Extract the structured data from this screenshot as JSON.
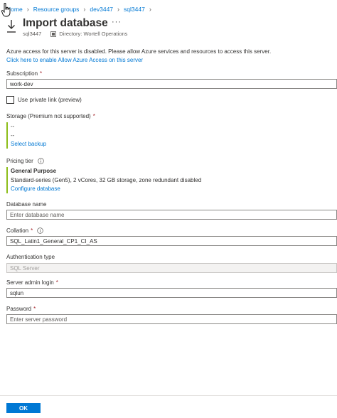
{
  "breadcrumb": [
    "Home",
    "Resource groups",
    "dev3447",
    "sql3447"
  ],
  "header": {
    "title": "Import database",
    "more": "···",
    "server": "sql3447",
    "directory": "Directory: Wortell Operations"
  },
  "notice": {
    "message": "Azure access for this server is disabled. Please allow Azure services and resources to access this server.",
    "link": "Click here to enable Allow Azure Access on this server"
  },
  "subscription": {
    "label": "Subscription",
    "value": "work-dev"
  },
  "private_link": {
    "label": "Use private link (preview)",
    "checked": false
  },
  "storage": {
    "label": "Storage (Premium not supported)",
    "line1": "--",
    "line2": "--",
    "link": "Select backup"
  },
  "pricing": {
    "label": "Pricing tier",
    "tier": "General Purpose",
    "details": "Standard-series (Gen5), 2 vCores, 32 GB storage, zone redundant disabled",
    "link": "Configure database"
  },
  "database_name": {
    "label": "Database name",
    "placeholder": "Enter database name"
  },
  "collation": {
    "label": "Collation",
    "value": "SQL_Latin1_General_CP1_CI_AS"
  },
  "authentication": {
    "label": "Authentication type",
    "value": "SQL Server"
  },
  "admin_login": {
    "label": "Server admin login",
    "value": "sqlun"
  },
  "password": {
    "label": "Password",
    "placeholder": "Enter server password"
  },
  "footer": {
    "ok_label": "OK"
  },
  "colors": {
    "accent": "#0078d4",
    "required": "#a4262c",
    "valid_bar": "#8cbd18"
  }
}
